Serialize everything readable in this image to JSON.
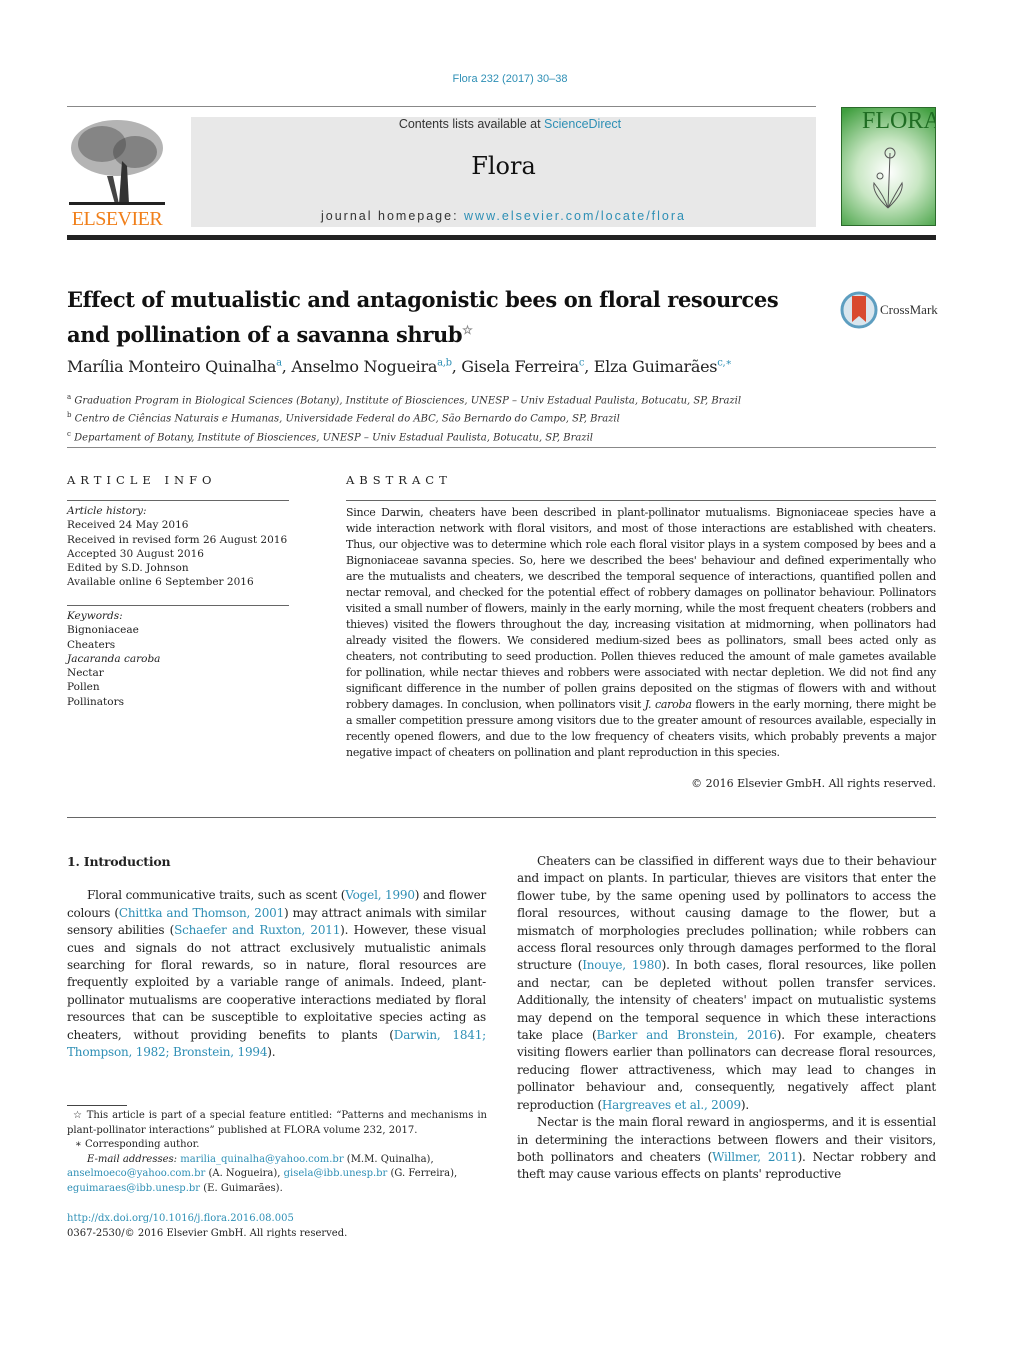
{
  "header": {
    "journal_ref": "Flora 232 (2017) 30–38",
    "contents_prefix": "Contents lists available at ",
    "contents_link": "ScienceDirect",
    "journal_name": "Flora",
    "homepage_prefix": "journal homepage: ",
    "homepage_link": "www.elsevier.com/locate/flora",
    "publisher_logo_text": "ELSEVIER",
    "cover_title": "FLORA",
    "brand_colors": {
      "elsevier_orange": "#f07f1a",
      "link_blue": "#2e8fb5",
      "cover_green": "#3f9e3e"
    }
  },
  "article": {
    "title": "Effect of mutualistic and antagonistic bees on floral resources and pollination of a savanna shrub",
    "title_mark": "☆",
    "crossmark_label": "CrossMark",
    "authors": [
      {
        "name": "Marília Monteiro Quinalha",
        "sup": "a"
      },
      {
        "name": "Anselmo Nogueira",
        "sup": "a,b"
      },
      {
        "name": "Gisela Ferreira",
        "sup": "c"
      },
      {
        "name": "Elza Guimarães",
        "sup": "c,∗"
      }
    ],
    "affiliations": [
      {
        "mark": "a",
        "text": "Graduation Program in Biological Sciences (Botany), Institute of Biosciences, UNESP – Univ Estadual Paulista, Botucatu, SP, Brazil"
      },
      {
        "mark": "b",
        "text": "Centro de Ciências Naturais e Humanas, Universidade Federal do ABC, São Bernardo do Campo, SP, Brazil"
      },
      {
        "mark": "c",
        "text": "Departament of Botany, Institute of Biosciences, UNESP – Univ Estadual Paulista, Botucatu, SP, Brazil"
      }
    ]
  },
  "article_info": {
    "label": "ARTICLE INFO",
    "history_label": "Article history:",
    "history": [
      "Received 24 May 2016",
      "Received in revised form 26 August 2016",
      "Accepted 30 August 2016",
      "Edited by S.D. Johnson",
      "Available online 6 September 2016"
    ],
    "keywords_label": "Keywords:",
    "keywords": [
      "Bignoniaceae",
      "Cheaters",
      "Jacaranda caroba",
      "Nectar",
      "Pollen",
      "Pollinators"
    ]
  },
  "abstract": {
    "label": "ABSTRACT",
    "text_1": "Since Darwin, cheaters have been described in plant-pollinator mutualisms. Bignoniaceae species have a wide interaction network with floral visitors, and most of those interactions are established with cheaters. Thus, our objective was to determine which role each floral visitor plays in a system composed by bees and a Bignoniaceae savanna species. So, here we described the bees' behaviour and defined experimentally who are the mutualists and cheaters, we described the temporal sequence of interactions, quantified pollen and nectar removal, and checked for the potential effect of robbery damages on pollinator behaviour. Pollinators visited a small number of flowers, mainly in the early morning, while the most frequent cheaters (robbers and thieves) visited the flowers throughout the day, increasing visitation at midmorning, when pollinators had already visited the flowers. We considered medium-sized bees as pollinators, small bees acted only as cheaters, not contributing to seed production. Pollen thieves reduced the amount of male gametes available for pollination, while nectar thieves and robbers were associated with nectar depletion. We did not find any significant difference in the number of pollen grains deposited on the stigmas of flowers with and without robbery damages. In conclusion, when pollinators visit ",
    "species_italic": "J. caroba",
    "text_2": " flowers in the early morning, there might be a smaller competition pressure among visitors due to the greater amount of resources available, especially in recently opened flowers, and due to the low frequency of cheaters visits, which probably prevents a major negative impact of cheaters on pollination and plant reproduction in this species.",
    "copyright": "© 2016 Elsevier GmbH. All rights reserved."
  },
  "body": {
    "section_heading": "1.  Introduction",
    "left_para": [
      {
        "t": "Floral communicative traits, such as scent ("
      },
      {
        "link": "Vogel, 1990"
      },
      {
        "t": ") and flower colours ("
      },
      {
        "link": "Chittka and Thomson, 2001"
      },
      {
        "t": ") may attract animals with similar sensory abilities ("
      },
      {
        "link": "Schaefer and Ruxton, 2011"
      },
      {
        "t": "). However, these visual cues and signals do not attract exclusively mutualistic animals searching for floral rewards, so in nature, floral resources are frequently exploited by a variable range of animals. Indeed, plant-pollinator mutualisms are cooperative interactions mediated by floral resources that can be susceptible to exploitative species acting as cheaters, without providing benefits to plants ("
      },
      {
        "link": "Darwin, 1841; Thompson, 1982; Bronstein, 1994"
      },
      {
        "t": ")."
      }
    ],
    "right_para_1": [
      {
        "t": "Cheaters can be classified in different ways due to their behaviour and impact on plants. In particular, thieves are visitors that enter the flower tube, by the same opening used by pollinators to access the floral resources, without causing damage to the flower, but a mismatch of morphologies precludes pollination; while robbers can access floral resources only through damages performed to the floral structure ("
      },
      {
        "link": "Inouye, 1980"
      },
      {
        "t": "). In both cases, floral resources, like pollen and nectar, can be depleted without pollen transfer services. Additionally, the intensity of cheaters' impact on mutualistic systems may depend on the temporal sequence in which these interactions take place ("
      },
      {
        "link": "Barker and Bronstein, 2016"
      },
      {
        "t": "). For example, cheaters visiting flowers earlier than pollinators can decrease floral resources, reducing flower attractiveness, which may lead to changes in pollinator behaviour and, consequently, negatively affect plant reproduction ("
      },
      {
        "link": "Hargreaves et al., 2009"
      },
      {
        "t": ")."
      }
    ],
    "right_para_2": [
      {
        "t": "Nectar is the main floral reward in angiosperms, and it is essential in determining the interactions between flowers and their visitors, both pollinators and cheaters ("
      },
      {
        "link": "Willmer, 2011"
      },
      {
        "t": "). Nectar robbery and theft may cause various effects on plants' reproductive"
      }
    ]
  },
  "footnotes": {
    "star_note": "☆  This article is part of a special feature entitled: “Patterns and mechanisms in plant-pollinator interactions” published at FLORA volume 232, 2017.",
    "corresponding": "∗  Corresponding author.",
    "email_label": "E-mail addresses: ",
    "emails": [
      {
        "email": "marilia_quinalha@yahoo.com.br",
        "who": " (M.M. Quinalha),"
      },
      {
        "email": "anselmoeco@yahoo.com.br",
        "who": " (A. Nogueira), "
      },
      {
        "email": "gisela@ibb.unesp.br",
        "who": " (G. Ferreira),"
      },
      {
        "email": "eguimaraes@ibb.unesp.br",
        "who": " (E. Guimarães)."
      }
    ],
    "doi": "http://dx.doi.org/10.1016/j.flora.2016.08.005",
    "issn_line": "0367-2530/© 2016 Elsevier GmbH. All rights reserved."
  }
}
